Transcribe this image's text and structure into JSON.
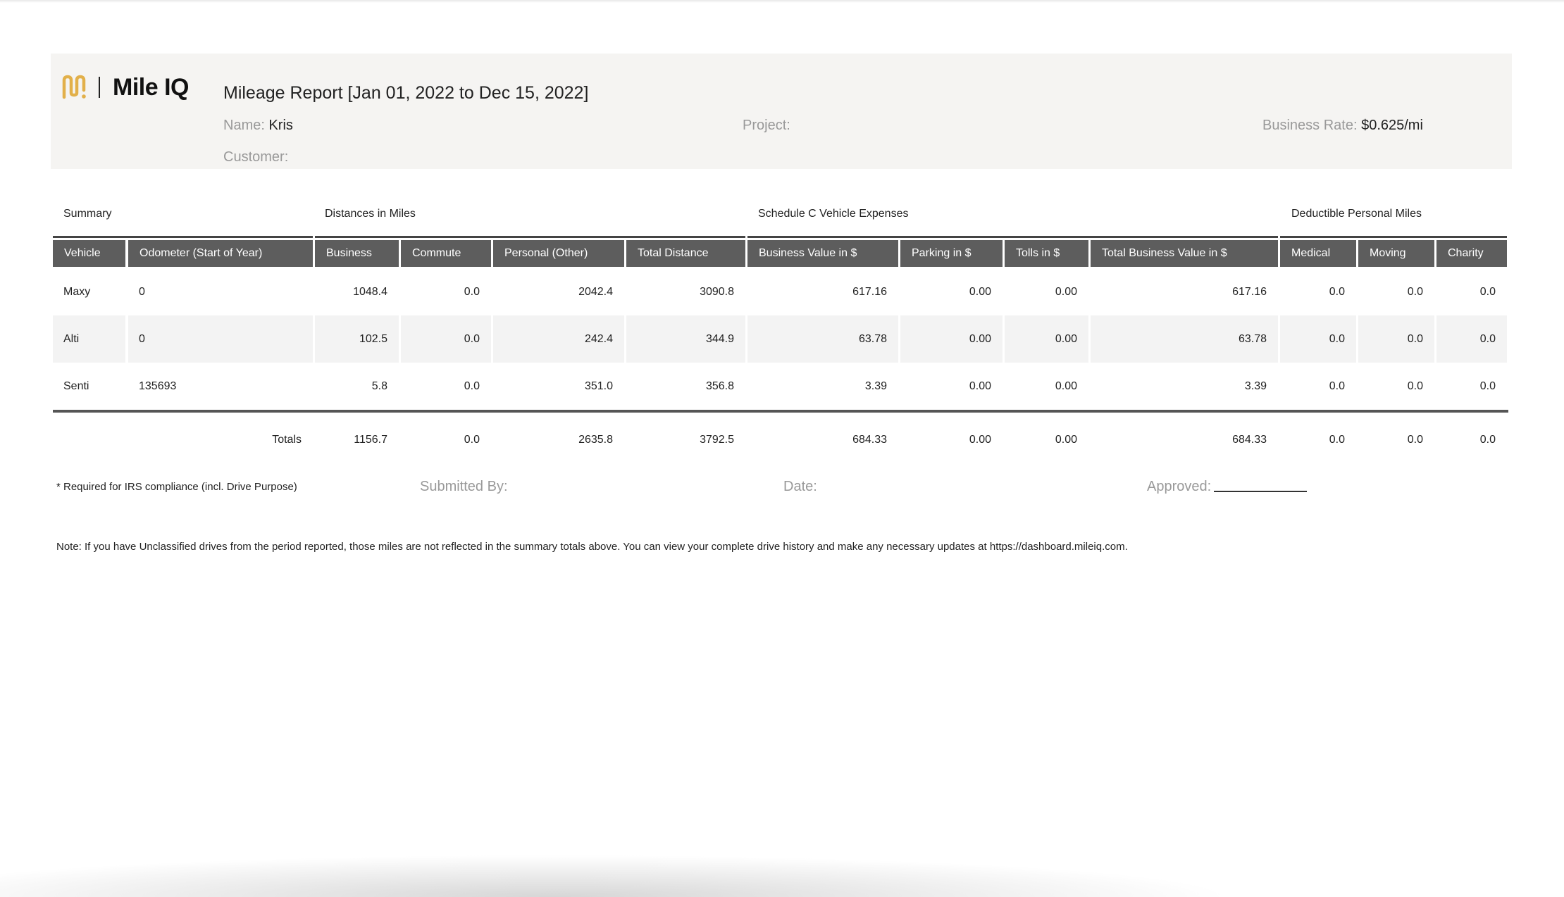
{
  "brand": {
    "logo_text": "Mile IQ",
    "accent_color": "#e2b04a"
  },
  "report": {
    "title": "Mileage Report [Jan 01, 2022 to Dec 15, 2022]",
    "name_label": "Name:",
    "name_value": "Kris",
    "project_label": "Project:",
    "project_value": "",
    "rate_label": "Business Rate:",
    "rate_value": "$0.625/mi",
    "customer_label": "Customer:",
    "customer_value": ""
  },
  "groups": {
    "summary": "Summary",
    "distances": "Distances in Miles",
    "schedule_c": "Schedule C Vehicle Expenses",
    "deductible": "Deductible Personal Miles"
  },
  "columns": {
    "vehicle": "Vehicle",
    "odometer": "Odometer (Start of Year)",
    "business": "Business",
    "commute": "Commute",
    "personal": "Personal (Other)",
    "total_distance": "Total Distance",
    "business_value": "Business Value in $",
    "parking": "Parking in $",
    "tolls": "Tolls in $",
    "total_business_value": "Total Business Value in $",
    "medical": "Medical",
    "moving": "Moving",
    "charity": "Charity"
  },
  "rows": [
    {
      "vehicle": "Maxy",
      "odometer": "0",
      "business": "1048.4",
      "commute": "0.0",
      "personal": "2042.4",
      "total_distance": "3090.8",
      "business_value": "617.16",
      "parking": "0.00",
      "tolls": "0.00",
      "total_business_value": "617.16",
      "medical": "0.0",
      "moving": "0.0",
      "charity": "0.0"
    },
    {
      "vehicle": "Alti",
      "odometer": "0",
      "business": "102.5",
      "commute": "0.0",
      "personal": "242.4",
      "total_distance": "344.9",
      "business_value": "63.78",
      "parking": "0.00",
      "tolls": "0.00",
      "total_business_value": "63.78",
      "medical": "0.0",
      "moving": "0.0",
      "charity": "0.0"
    },
    {
      "vehicle": "Senti",
      "odometer": "135693",
      "business": "5.8",
      "commute": "0.0",
      "personal": "351.0",
      "total_distance": "356.8",
      "business_value": "3.39",
      "parking": "0.00",
      "tolls": "0.00",
      "total_business_value": "3.39",
      "medical": "0.0",
      "moving": "0.0",
      "charity": "0.0"
    }
  ],
  "totals": {
    "label": "Totals",
    "business": "1156.7",
    "commute": "0.0",
    "personal": "2635.8",
    "total_distance": "3792.5",
    "business_value": "684.33",
    "parking": "0.00",
    "tolls": "0.00",
    "total_business_value": "684.33",
    "medical": "0.0",
    "moving": "0.0",
    "charity": "0.0"
  },
  "footer": {
    "irs_note": "* Required for IRS compliance (incl. Drive Purpose)",
    "submitted_by": "Submitted By:",
    "date": "Date:",
    "approved": "Approved:",
    "note": "Note: If you have Unclassified drives from the period reported, those miles are not reflected in the summary totals above. You can view your complete drive history and make any necessary updates at https://dashboard.mileiq.com."
  }
}
